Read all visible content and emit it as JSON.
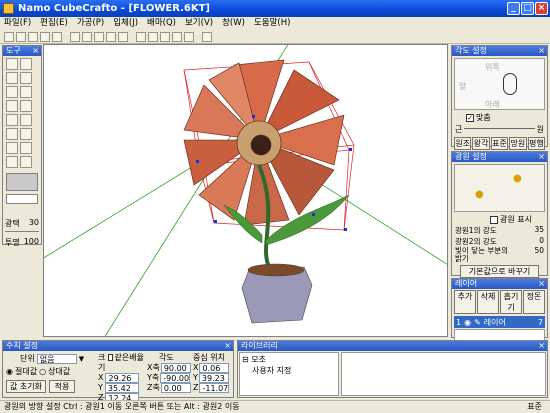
{
  "window": {
    "app": "Namo CubeCrafto",
    "document": "[FLOWER.6KT]"
  },
  "menu": [
    "파일(F)",
    "편집(E)",
    "가공(P)",
    "입체(J)",
    "배마(Q)",
    "보기(V)",
    "창(W)",
    "도움말(H)"
  ],
  "tools_panel": {
    "title": "도구",
    "alpha_label": "광택",
    "alpha_value": "30",
    "opacity_label": "투명",
    "opacity_value": "100"
  },
  "angle_panel": {
    "title": "각도 설정",
    "labels": [
      "위쪽",
      "앞",
      "아래"
    ],
    "check_label": "맞춤",
    "left_tag": "근",
    "right_tag": "원",
    "buttons": [
      "원조",
      "왕각",
      "표준",
      "망원",
      "평행"
    ]
  },
  "light_panel": {
    "title": "광원 설정",
    "show_label": "광원 표시",
    "light1_label": "광원1의 강도",
    "light1_value": "35",
    "light2_label": "광원2의 강도",
    "light2_value": "0",
    "ambient_label": "빛이 닿는 부분의 밝기",
    "ambient_value": "50",
    "reset_button": "기본값으로 바꾸기"
  },
  "layer_panel": {
    "title": "레이어",
    "buttons": [
      "추가",
      "삭제",
      "흡기기",
      "정돈"
    ],
    "row": {
      "index": "1",
      "name": "레이어",
      "count": "7"
    }
  },
  "size_panel": {
    "title": "수치 설정",
    "unit_label": "단위",
    "unit_value": "없음",
    "abs_label": "절대값",
    "rel_label": "상대값",
    "reset_button": "값 초기화",
    "apply_button": "적용",
    "size_header": "크기",
    "same_ratio": "같은배율",
    "angle_header": "각도",
    "center_header": "중심 위치",
    "x_label": "X",
    "x_value": "29.26",
    "y_label": "Y",
    "y_value": "35.42",
    "z_label": "Z",
    "z_value": "12.24",
    "ax_label": "X축",
    "ax_value": "90.00",
    "ay_label": "Y축",
    "ay_value": "-90.00",
    "az_label": "Z축",
    "az_value": "0.00",
    "cx_label": "X",
    "cx_value": "0.06",
    "cy_label": "Y",
    "cy_value": "39.23",
    "cz_label": "Z",
    "cz_value": "-11.07"
  },
  "library_panel": {
    "title": "라이브러리",
    "root": "모조",
    "child": "사용자 지정"
  },
  "status": {
    "text": "광원의 방향 설정  Ctrl : 광원1 이동     오른쪽 버튼 또는 Alt : 광원2 이동",
    "mode": "표준"
  }
}
